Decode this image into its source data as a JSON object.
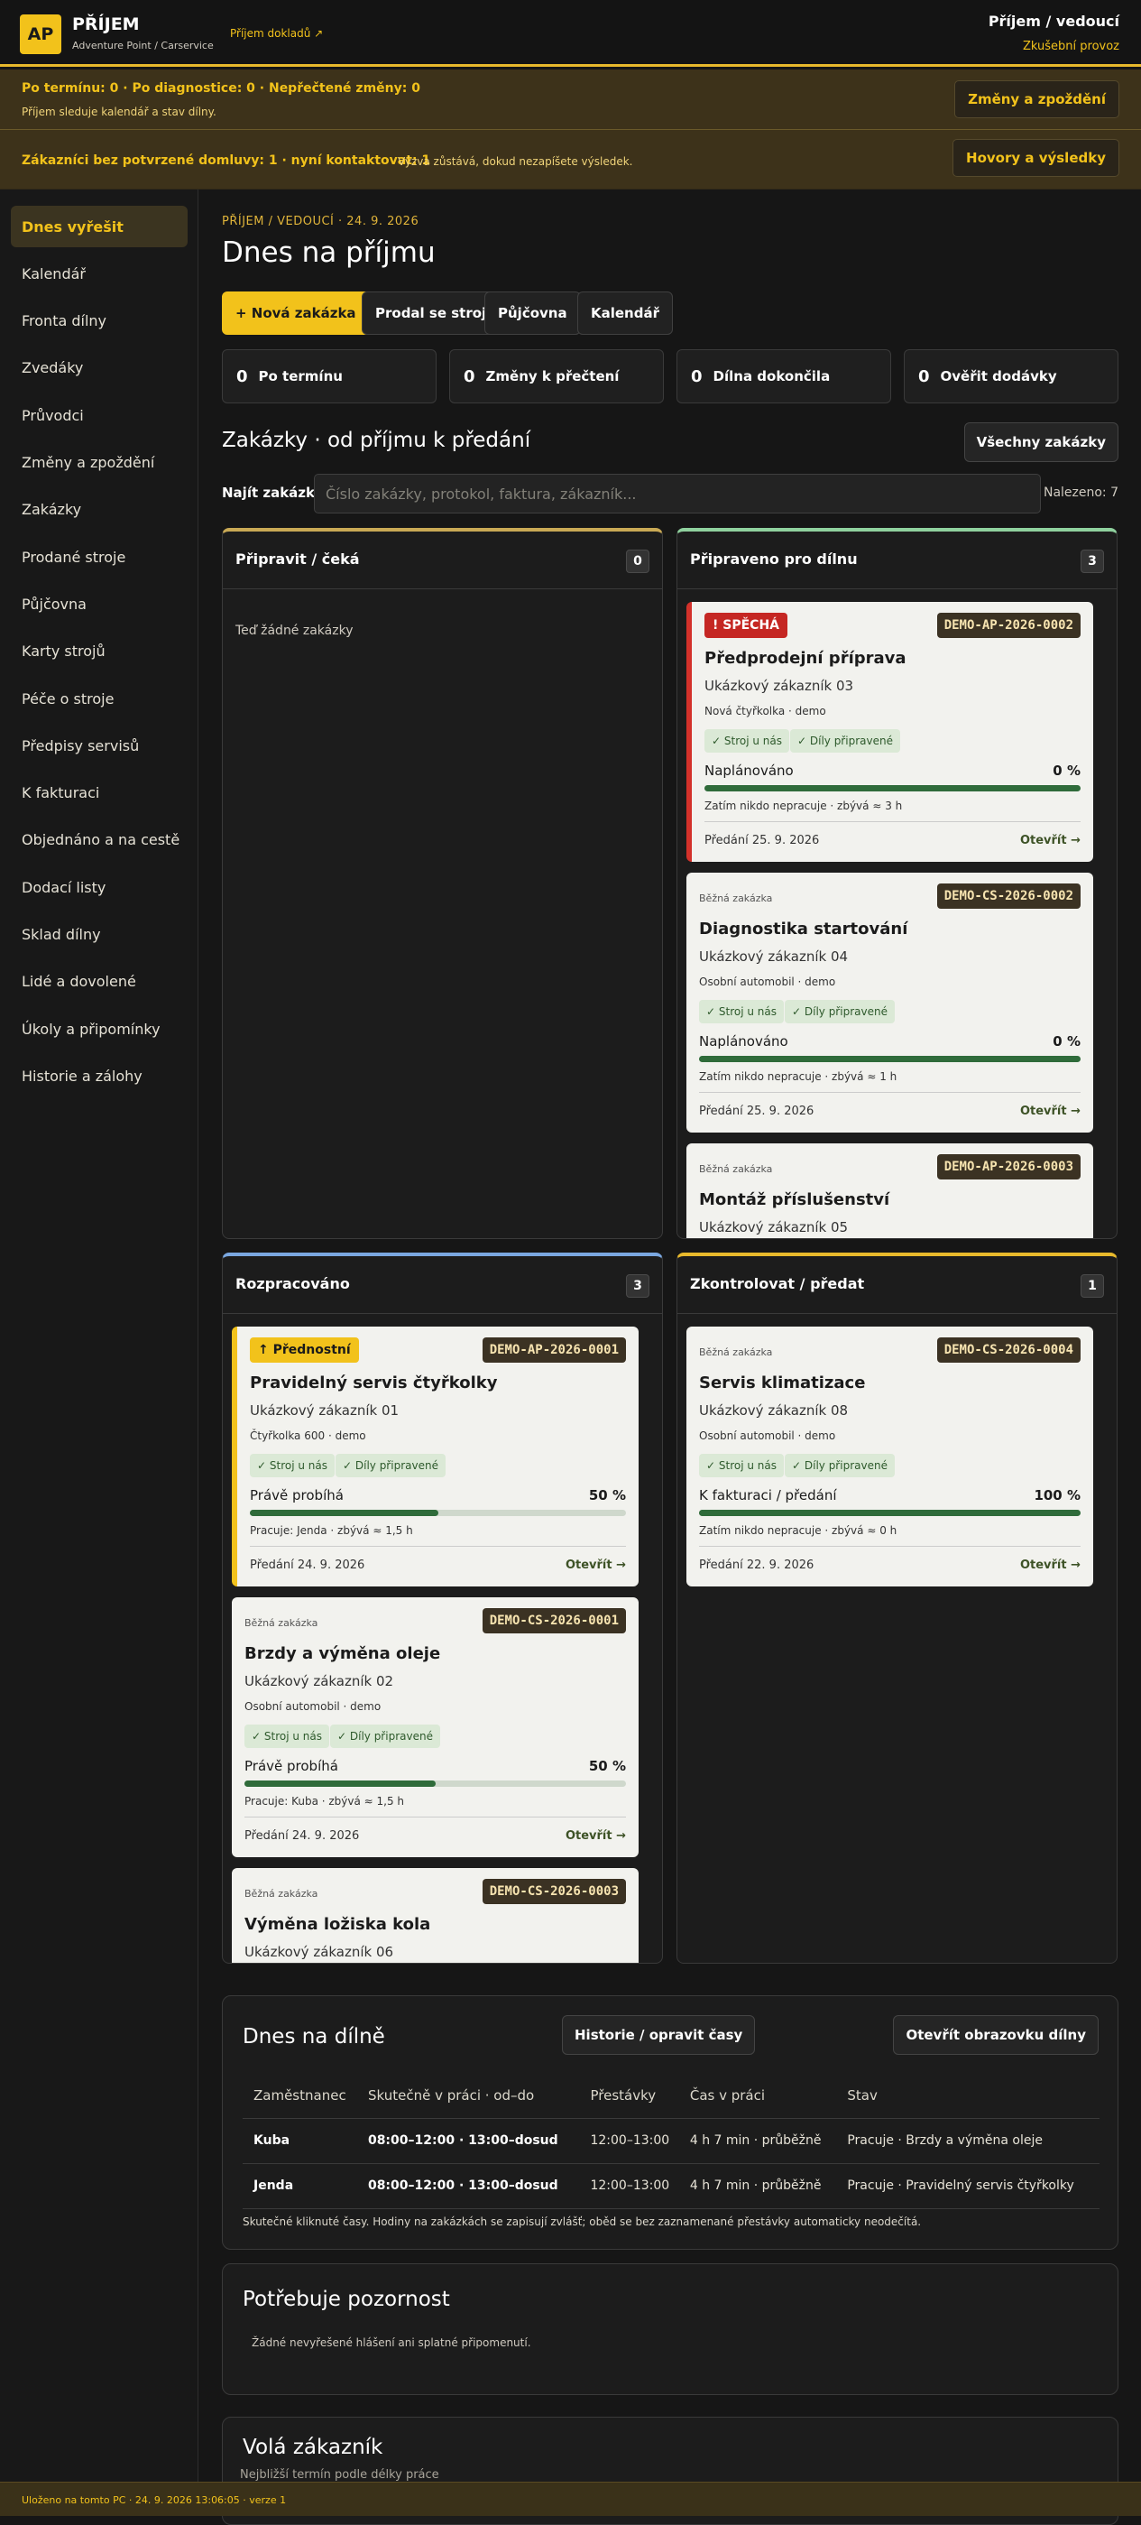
{
  "header": {
    "logo": "AP",
    "title": "PŘÍJEM",
    "subtitle": "Adventure Point / Carservice",
    "doc_link": "Příjem dokladů ↗",
    "role": "Příjem / vedoucí",
    "mode": "Zkušební provoz"
  },
  "alerts": [
    {
      "strong": "Po termínu: 0 · Po diagnostice: 0 · Nepřečtené změny: 0",
      "sub": "Příjem sleduje kalendář a stav dílny.",
      "button": "Změny a zpoždění"
    },
    {
      "strong": "Zákazníci bez potvrzené domluvy: 1 · nyní kontaktovat: 1",
      "sub": "Výzva zůstává, dokud nezapíšete výsledek.",
      "button": "Hovory a výsledky"
    }
  ],
  "sidebar": {
    "items": [
      "Dnes vyřešit",
      "Kalendář",
      "Fronta dílny",
      "Zvedáky",
      "Průvodci",
      "Změny a zpoždění",
      "Zakázky",
      "Prodané stroje",
      "Půjčovna",
      "Karty strojů",
      "Péče o stroje",
      "Předpisy servisů",
      "K fakturaci",
      "Objednáno a na cestě",
      "Dodací listy",
      "Sklad dílny",
      "Lidé a dovolené",
      "Úkoly a připomínky",
      "Historie a zálohy"
    ],
    "active": 0
  },
  "main": {
    "breadcrumb": "PŘÍJEM / VEDOUCÍ · 24. 9. 2026",
    "title": "Dnes na příjmu",
    "actions": {
      "new_order": "+ Nová zakázka",
      "sold_machine": "Prodal se stroj",
      "rental": "Půjčovna",
      "calendar": "Kalendář"
    },
    "stats": [
      {
        "value": "0",
        "label": "Po termínu"
      },
      {
        "value": "0",
        "label": "Změny k přečtení"
      },
      {
        "value": "0",
        "label": "Dílna dokončila"
      },
      {
        "value": "0",
        "label": "Ověřit dodávky"
      }
    ],
    "orders_title": "Zakázky · od příjmu k předání",
    "all_orders": "Všechny zakázky",
    "search": {
      "label": "Najít zakázku",
      "placeholder": "Číslo zakázky, protokol, faktura, zákazník...",
      "value": "",
      "found": "Nalezeno: 7"
    }
  },
  "columns": [
    {
      "title": "Připravit / čeká",
      "count": "0",
      "accent": "#c9a955",
      "empty": "Teď žádné zakázky",
      "cards": []
    },
    {
      "title": "Připraveno pro dílnu",
      "count": "3",
      "accent": "#8fd19e",
      "empty": "",
      "cards": [
        {
          "flag": "urgent",
          "badge": "! SPĚCHÁ",
          "code": "DEMO-AP-2026-0002",
          "title": "Předprodejní příprava",
          "customer": "Ukázkový zákazník 03",
          "machine": "Nová čtyřkolka · demo",
          "chips": [
            "✓ Stroj u nás",
            "✓ Díly připravené"
          ],
          "status": "Naplánováno",
          "pct": "0 %",
          "progress": 0,
          "worker": "Zatím nikdo nepracuje · zbývá ≈ 3 h",
          "due": "Předání 25. 9. 2026",
          "open": "Otevřít →"
        },
        {
          "flag": "normal",
          "badge": "Běžná zakázka",
          "code": "DEMO-CS-2026-0002",
          "title": "Diagnostika startování",
          "customer": "Ukázkový zákazník 04",
          "machine": "Osobní automobil · demo",
          "chips": [
            "✓ Stroj u nás",
            "✓ Díly připravené"
          ],
          "status": "Naplánováno",
          "pct": "0 %",
          "progress": 0,
          "worker": "Zatím nikdo nepracuje · zbývá ≈ 1 h",
          "due": "Předání 25. 9. 2026",
          "open": "Otevřít →"
        },
        {
          "flag": "normal",
          "badge": "Běžná zakázka",
          "code": "DEMO-AP-2026-0003",
          "title": "Montáž příslušenství",
          "customer": "Ukázkový zákazník 05",
          "machine": "",
          "chips": [],
          "status": "",
          "pct": "",
          "progress": 0,
          "worker": "",
          "due": "",
          "open": ""
        }
      ]
    },
    {
      "title": "Rozpracováno",
      "count": "3",
      "accent": "#7aa7e0",
      "empty": "",
      "cards": [
        {
          "flag": "prio",
          "badge": "↑ Přednostní",
          "code": "DEMO-AP-2026-0001",
          "title": "Pravidelný servis čtyřkolky",
          "customer": "Ukázkový zákazník 01",
          "machine": "Čtyřkolka 600 · demo",
          "chips": [
            "✓ Stroj u nás",
            "✓ Díly připravené"
          ],
          "status": "Právě probíhá",
          "pct": "50 %",
          "progress": 0.5,
          "worker": "Pracuje: Jenda · zbývá ≈ 1,5 h",
          "due": "Předání 24. 9. 2026",
          "open": "Otevřít →"
        },
        {
          "flag": "normal",
          "badge": "Běžná zakázka",
          "code": "DEMO-CS-2026-0001",
          "title": "Brzdy a výměna oleje",
          "customer": "Ukázkový zákazník 02",
          "machine": "Osobní automobil · demo",
          "chips": [
            "✓ Stroj u nás",
            "✓ Díly připravené"
          ],
          "status": "Právě probíhá",
          "pct": "50 %",
          "progress": 0.5,
          "worker": "Pracuje: Kuba · zbývá ≈ 1,5 h",
          "due": "Předání 24. 9. 2026",
          "open": "Otevřít →"
        },
        {
          "flag": "normal",
          "badge": "Běžná zakázka",
          "code": "DEMO-CS-2026-0003",
          "title": "Výměna ložiska kola",
          "customer": "Ukázkový zákazník 06",
          "machine": "",
          "chips": [],
          "status": "",
          "pct": "",
          "progress": 0,
          "worker": "",
          "due": "",
          "open": ""
        }
      ]
    },
    {
      "title": "Zkontrolovat / předat",
      "count": "1",
      "accent": "#e8b92c",
      "empty": "",
      "cards": [
        {
          "flag": "normal",
          "badge": "Běžná zakázka",
          "code": "DEMO-CS-2026-0004",
          "title": "Servis klimatizace",
          "customer": "Ukázkový zákazník 08",
          "machine": "Osobní automobil · demo",
          "chips": [
            "✓ Stroj u nás",
            "✓ Díly připravené"
          ],
          "status": "K fakturaci / předání",
          "pct": "100 %",
          "progress": 1,
          "worker": "Zatím nikdo nepracuje · zbývá ≈ 0 h",
          "due": "Předání 22. 9. 2026",
          "open": "Otevřít →"
        }
      ]
    }
  ],
  "workshop": {
    "title": "Dnes na dílně",
    "history_btn": "Historie / opravit časy",
    "screen_btn": "Otevřít obrazovku dílny",
    "headers": [
      "Zaměstnanec",
      "Skutečně v práci · od–do",
      "Přestávky",
      "Čas v práci",
      "Stav"
    ],
    "rows": [
      [
        "Kuba",
        "08:00–12:00 · 13:00–dosud",
        "12:00–13:00",
        "4 h 7 min · průběžně",
        "Pracuje · Brzdy a výměna oleje"
      ],
      [
        "Jenda",
        "08:00–12:00 · 13:00–dosud",
        "12:00–13:00",
        "4 h 7 min · průběžně",
        "Pracuje · Pravidelný servis čtyřkolky"
      ]
    ],
    "note": "Skutečné kliknuté časy. Hodiny na zakázkách se zapisují zvlášť; oběd se bez zaznamenané přestávky automaticky neodečítá."
  },
  "attention": {
    "title": "Potřebuje pozornost",
    "text": "Žádné nevyřešené hlášení ani splatné připomenutí."
  },
  "calls": {
    "title": "Volá zákazník",
    "subtitle": "Nejbližší termín podle délky práce"
  },
  "footer": "Uloženo na tomto PC · 24. 9. 2026 13:06:05 · verze 1"
}
